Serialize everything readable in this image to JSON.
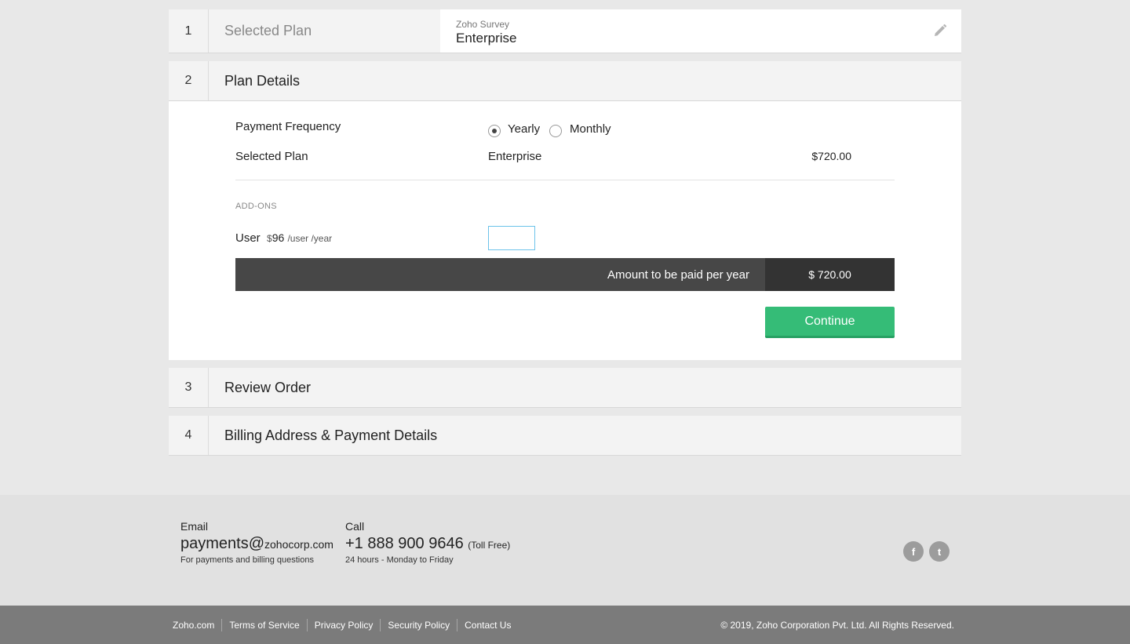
{
  "steps": [
    {
      "num": "1",
      "title": "Selected Plan"
    },
    {
      "num": "2",
      "title": "Plan Details"
    },
    {
      "num": "3",
      "title": "Review Order"
    },
    {
      "num": "4",
      "title": "Billing Address & Payment Details"
    }
  ],
  "summary": {
    "product": "Zoho Survey",
    "plan": "Enterprise",
    "edit_icon": "pencil-icon"
  },
  "plan_details": {
    "payment_frequency_label": "Payment Frequency",
    "options": [
      {
        "label": "Yearly",
        "checked": true
      },
      {
        "label": "Monthly",
        "checked": false
      }
    ],
    "selected_plan_label": "Selected Plan",
    "selected_plan_value": "Enterprise",
    "selected_plan_price": "$720.00",
    "addons_heading": "ADD-ONS",
    "addon": {
      "name": "User",
      "currency": "$",
      "price": "96",
      "unit": "/user /year",
      "quantity": ""
    },
    "amount_label": "Amount to be paid per year",
    "amount_value": "$ 720.00",
    "continue_label": "Continue"
  },
  "footer": {
    "email_label": "Email",
    "email_user": "payments@",
    "email_domain": "zohocorp.com",
    "email_sub": "For payments and billing questions",
    "call_label": "Call",
    "phone": "+1 888 900 9646",
    "toll": "(Toll Free)",
    "call_sub": "24 hours - Monday to Friday",
    "social": [
      {
        "icon": "facebook-icon",
        "glyph": "f"
      },
      {
        "icon": "twitter-icon",
        "glyph": "t"
      }
    ]
  },
  "bottom": {
    "links": [
      "Zoho.com",
      "Terms of Service",
      "Privacy Policy",
      "Security Policy",
      "Contact Us"
    ],
    "copyright": "© 2019, Zoho Corporation Pvt. Ltd. All Rights Reserved."
  },
  "colors": {
    "accent": "#35bc77",
    "amount_bar": "#474747",
    "footer_bar": "#7b7b7b"
  }
}
